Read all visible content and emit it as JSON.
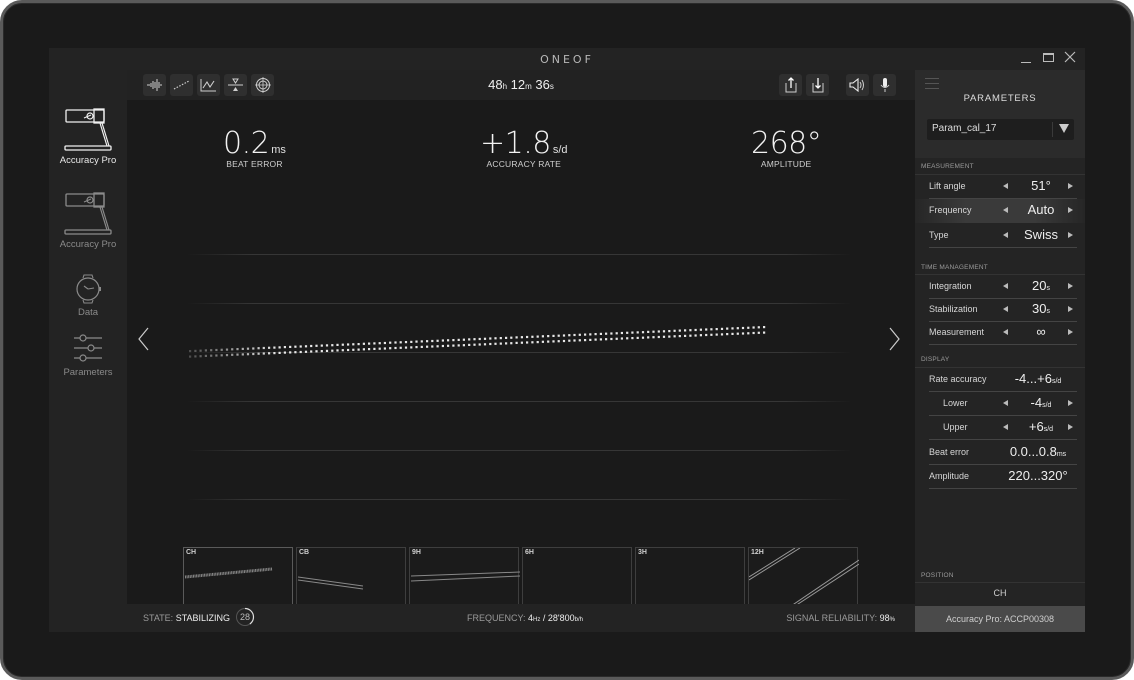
{
  "window": {
    "title": "ONEOF",
    "controls": [
      "minimize",
      "maximize",
      "close"
    ]
  },
  "sidebar": {
    "items": [
      {
        "label": "Accuracy Pro",
        "icon": "timegrapher-device-icon",
        "active": true
      },
      {
        "label": "Accuracy Pro",
        "icon": "timegrapher-device-icon",
        "active": false
      },
      {
        "label": "Data",
        "icon": "watch-icon",
        "active": false
      },
      {
        "label": "Parameters",
        "icon": "sliders-icon",
        "active": false
      }
    ]
  },
  "toolbar": {
    "left_buttons": [
      "waveform-icon",
      "dotted-trace-icon",
      "line-graph-icon",
      "balance-icon",
      "target-icon"
    ],
    "right_buttons": [
      "export-icon",
      "import-icon",
      "speaker-icon",
      "microphone-icon"
    ],
    "timer": {
      "hours": "48",
      "h": "h",
      "minutes": "12",
      "m": "m",
      "seconds": "36",
      "s": "s"
    }
  },
  "metrics": {
    "beat_error": {
      "value": "0.2",
      "unit": "ms",
      "label": "BEAT ERROR"
    },
    "accuracy_rate": {
      "value": "+1.8",
      "unit": "s/d",
      "label": "ACCURACY RATE"
    },
    "amplitude": {
      "value": "268°",
      "unit": "",
      "label": "AMPLITUDE"
    }
  },
  "trace": {
    "description": "two parallel dotted traces rising left to right",
    "points": 110
  },
  "positions": [
    {
      "label": "CH",
      "active": true
    },
    {
      "label": "CB",
      "active": false
    },
    {
      "label": "9H",
      "active": false
    },
    {
      "label": "6H",
      "active": false
    },
    {
      "label": "3H",
      "active": false
    },
    {
      "label": "12H",
      "active": false
    }
  ],
  "pager": {
    "count": 5,
    "active": 0
  },
  "status": {
    "state_label": "STATE:",
    "state_value": "STABILIZING",
    "counter": "28",
    "counter_progress": 0.4,
    "frequency_label": "FREQUENCY:",
    "frequency_hz": "4",
    "frequency_hz_unit": "Hz",
    "frequency_sep": " / ",
    "frequency_bph": "28'800",
    "frequency_bph_unit": "b/h",
    "reliability_label": "SIGNAL RELIABILITY:",
    "reliability_value": "98",
    "reliability_unit": "%"
  },
  "panel": {
    "title": "PARAMETERS",
    "preset": "Param_cal_17",
    "sections": {
      "measurement": "MEASUREMENT",
      "time_management": "TIME MANAGEMENT",
      "display": "DISPLAY",
      "position": "POSITION"
    },
    "measurement": {
      "lift_angle": {
        "label": "Lift angle",
        "value": "51°"
      },
      "frequency": {
        "label": "Frequency",
        "value": "Auto"
      },
      "type": {
        "label": "Type",
        "value": "Swiss"
      }
    },
    "time_management": {
      "integration": {
        "label": "Integration",
        "value": "20",
        "unit": "s"
      },
      "stabilization": {
        "label": "Stabilization",
        "value": "30",
        "unit": "s"
      },
      "measurement": {
        "label": "Measurement",
        "value": "∞"
      }
    },
    "display": {
      "rate_accuracy": {
        "label": "Rate accuracy",
        "value": "-4...+6",
        "unit": "s/d"
      },
      "lower": {
        "label": "Lower",
        "value": "-4",
        "unit": "s/d"
      },
      "upper": {
        "label": "Upper",
        "value": "+6",
        "unit": "s/d"
      },
      "beat_error": {
        "label": "Beat error",
        "value": "0.0...0.8",
        "unit": "ms"
      },
      "amplitude": {
        "label": "Amplitude",
        "value": "220...320°"
      }
    },
    "position_value": "CH",
    "device_id": "Accuracy Pro: ACCP00308"
  }
}
